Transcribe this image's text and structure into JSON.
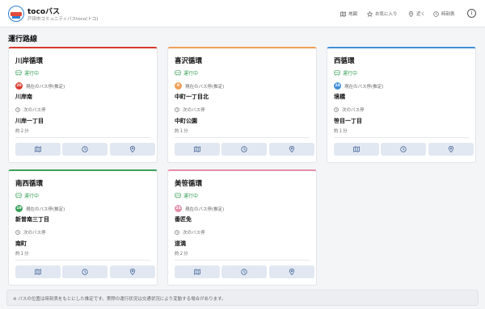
{
  "header": {
    "title": "tocoバス",
    "subtitle": "戸田市コミュニティバスtoco(トコ)",
    "nav": {
      "map": "地図",
      "favorites": "お気に入り",
      "nearby": "近く",
      "timetable": "時刻表"
    },
    "info": "i"
  },
  "page_title": "運行路線",
  "labels": {
    "current_stop": "現在のバス停(推定)",
    "next_stop": "次のバス停"
  },
  "routes": [
    {
      "name": "川岸循環",
      "color": "#d83a2c",
      "status": "運行中",
      "badge": "20",
      "current_stop": "川岸南",
      "next_stop": "川岸一丁目",
      "eta": "約２分"
    },
    {
      "name": "喜沢循環",
      "color": "#f0a05a",
      "status": "運行中",
      "badge": "9",
      "current_stop": "中町一丁目北",
      "next_stop": "中町公園",
      "eta": "約１分"
    },
    {
      "name": "西循環",
      "color": "#3f8fd8",
      "status": "運行中",
      "badge": "24",
      "current_stop": "境橋",
      "next_stop": "笹目一丁目",
      "eta": "約１分"
    },
    {
      "name": "南西循環",
      "color": "#3aa15a",
      "status": "運行中",
      "badge": "19",
      "current_stop": "新曽南三丁目",
      "next_stop": "南町",
      "eta": "約１分"
    },
    {
      "name": "美笹循環",
      "color": "#e48fa8",
      "status": "運行中",
      "badge": "24",
      "current_stop": "番匠免",
      "next_stop": "道満",
      "eta": "約２分"
    }
  ],
  "footer": "※ バスの位置は時刻表をもとにした推定です。実際の運行状況は交通状況により変動する場合があります。"
}
